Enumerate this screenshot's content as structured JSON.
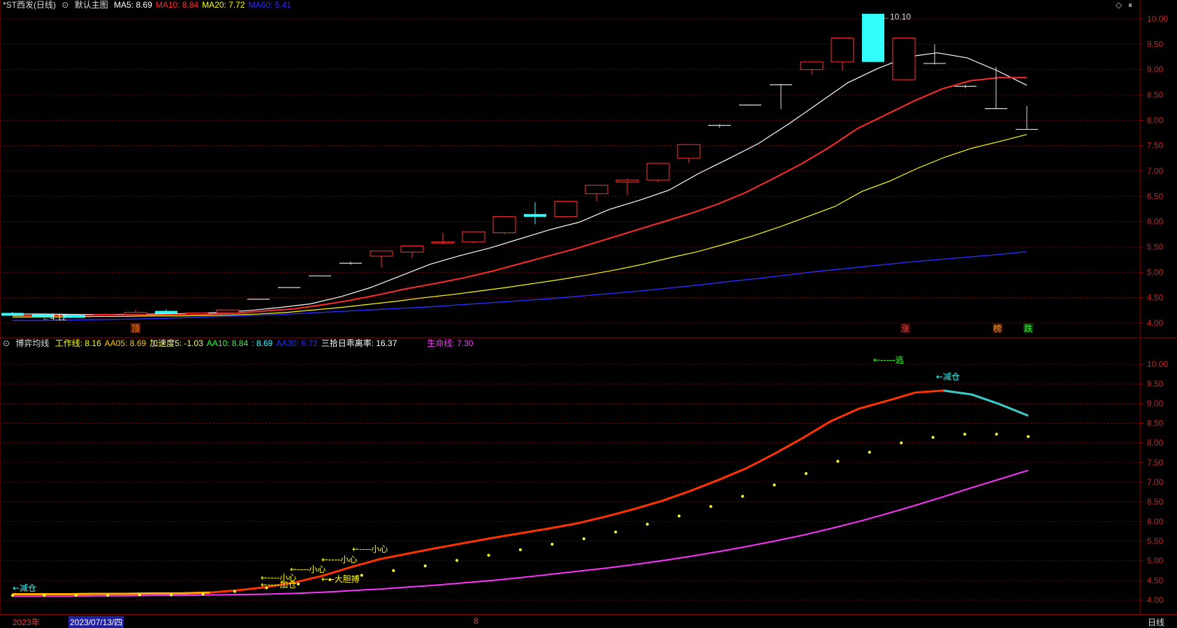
{
  "main_panel": {
    "title": "*ST西发(日线)",
    "template": "默认主图",
    "ma_labels": [
      {
        "text": "MA5: 8.69",
        "color": "#ffffff"
      },
      {
        "text": "MA10: 8.84",
        "color": "#ff2a2a"
      },
      {
        "text": "MA20: 7.72",
        "color": "#ffff00"
      },
      {
        "text": "MA60: 5.41",
        "color": "#2b2bff"
      }
    ],
    "high_label": "10.10",
    "low_label": "4.12",
    "y_ticks": [
      "10.00",
      "9.50",
      "9.00",
      "8.50",
      "8.00",
      "7.50",
      "7.00",
      "6.50",
      "6.00",
      "5.50",
      "5.00",
      "4.50",
      "4.00"
    ],
    "markers": [
      {
        "text": "顶",
        "color": "#ff8c00",
        "bg": "#5a1a00"
      },
      {
        "text": "涨",
        "color": "#ff4040",
        "bg": "#3a0000"
      },
      {
        "text": "榜",
        "color": "#ff9933",
        "bg": "#3a1a00"
      },
      {
        "text": "跌",
        "color": "#33ff33",
        "bg": "#003a00"
      }
    ],
    "icons": [
      {
        "name": "diamond-icon",
        "glyph": "◇"
      },
      {
        "name": "pause-icon",
        "glyph": "⏸"
      }
    ]
  },
  "sub_panel": {
    "indicator_name": "博弈均线",
    "labels": [
      {
        "text": "工作线: 8.16",
        "color": "#ffff00"
      },
      {
        "text": "AA05: 8.69",
        "color": "#ffcc00"
      },
      {
        "text": "加速度5: -1.03",
        "color": "#ffff66"
      },
      {
        "text": "AA10: 8.84",
        "color": "#33ff33"
      },
      {
        "text": ": 8.69",
        "color": "#33ffff"
      },
      {
        "text": "AA30: 6.72",
        "color": "#2b2bff"
      },
      {
        "text": "三拾日乖离率: 16.37",
        "color": "#ffffff"
      },
      {
        "text": "生命线: 7.30",
        "color": "#ff33ff"
      }
    ],
    "y_ticks": [
      "10.00",
      "9.50",
      "9.00",
      "8.50",
      "8.00",
      "7.50",
      "7.00",
      "6.50",
      "6.00",
      "5.50",
      "5.00",
      "4.50",
      "4.00"
    ],
    "annotations": [
      {
        "text": "←减仓",
        "color": "#33ffff"
      },
      {
        "text": "←----小心",
        "color": "#ffff00"
      },
      {
        "text": "←----加仓",
        "color": "#ffff00"
      },
      {
        "text": "←----小心",
        "color": "#ffff00"
      },
      {
        "text": "←----小心",
        "color": "#ffff00"
      },
      {
        "text": "←----小心",
        "color": "#ffff00"
      },
      {
        "text": "←--大胆搏",
        "color": "#ffff00"
      },
      {
        "text": "←-----逃",
        "color": "#33ff33"
      },
      {
        "text": "←减仓",
        "color": "#33ffff"
      }
    ]
  },
  "bottom_bar": {
    "year": "2023年",
    "date": "2023/07/13/四",
    "mid": "8",
    "period": "日线"
  },
  "chart_data": [
    {
      "type": "candlestick",
      "title": "*ST西发(日线)",
      "ylim": [
        3.85,
        10.15
      ],
      "candles": [
        {
          "o": 4.2,
          "h": 4.22,
          "l": 4.16,
          "c": 4.18,
          "color": "cyan"
        },
        {
          "o": 4.17,
          "h": 4.19,
          "l": 4.15,
          "c": 4.17,
          "color": "cyan"
        },
        {
          "o": 4.16,
          "h": 4.18,
          "l": 4.13,
          "c": 4.15,
          "color": "cyan"
        },
        {
          "o": 4.15,
          "h": 4.19,
          "l": 4.12,
          "c": 4.17,
          "color": "red"
        },
        {
          "o": 4.17,
          "h": 4.26,
          "l": 4.15,
          "c": 4.21,
          "color": "red"
        },
        {
          "o": 4.24,
          "h": 4.27,
          "l": 4.18,
          "c": 4.21,
          "color": "cyan"
        },
        {
          "o": 4.17,
          "h": 4.21,
          "l": 4.15,
          "c": 4.2,
          "color": "red"
        },
        {
          "o": 4.2,
          "h": 4.26,
          "l": 4.18,
          "c": 4.26,
          "color": "red"
        },
        {
          "o": 4.47,
          "h": 4.47,
          "l": 4.47,
          "c": 4.47,
          "color": "white"
        },
        {
          "o": 4.7,
          "h": 4.7,
          "l": 4.7,
          "c": 4.7,
          "color": "white"
        },
        {
          "o": 4.93,
          "h": 4.93,
          "l": 4.93,
          "c": 4.93,
          "color": "white"
        },
        {
          "o": 5.18,
          "h": 5.21,
          "l": 5.15,
          "c": 5.18,
          "color": "white"
        },
        {
          "o": 5.32,
          "h": 5.42,
          "l": 5.1,
          "c": 5.42,
          "color": "red"
        },
        {
          "o": 5.4,
          "h": 5.52,
          "l": 5.28,
          "c": 5.52,
          "color": "red"
        },
        {
          "o": 5.6,
          "h": 5.78,
          "l": 5.55,
          "c": 5.6,
          "color": "red"
        },
        {
          "o": 5.6,
          "h": 5.8,
          "l": 5.57,
          "c": 5.8,
          "color": "red"
        },
        {
          "o": 5.78,
          "h": 6.1,
          "l": 5.75,
          "c": 6.1,
          "color": "red"
        },
        {
          "o": 6.15,
          "h": 6.38,
          "l": 5.95,
          "c": 6.12,
          "color": "cyan"
        },
        {
          "o": 6.1,
          "h": 6.4,
          "l": 6.08,
          "c": 6.4,
          "color": "red"
        },
        {
          "o": 6.55,
          "h": 6.72,
          "l": 6.4,
          "c": 6.72,
          "color": "red"
        },
        {
          "o": 6.78,
          "h": 6.85,
          "l": 6.52,
          "c": 6.82,
          "color": "red"
        },
        {
          "o": 6.82,
          "h": 7.15,
          "l": 6.78,
          "c": 7.15,
          "color": "red"
        },
        {
          "o": 7.25,
          "h": 7.52,
          "l": 7.16,
          "c": 7.52,
          "color": "red"
        },
        {
          "o": 7.9,
          "h": 7.92,
          "l": 7.85,
          "c": 7.9,
          "color": "white"
        },
        {
          "o": 8.3,
          "h": 8.31,
          "l": 8.29,
          "c": 8.3,
          "color": "white"
        },
        {
          "o": 8.7,
          "h": 8.72,
          "l": 8.22,
          "c": 8.7,
          "color": "white"
        },
        {
          "o": 9.0,
          "h": 9.15,
          "l": 8.9,
          "c": 9.15,
          "color": "red"
        },
        {
          "o": 9.15,
          "h": 9.62,
          "l": 8.98,
          "c": 9.62,
          "color": "red"
        },
        {
          "o": 10.1,
          "h": 10.1,
          "l": 9.15,
          "c": 9.15,
          "color": "cyan"
        },
        {
          "o": 8.8,
          "h": 9.62,
          "l": 8.78,
          "c": 9.62,
          "color": "red"
        },
        {
          "o": 9.12,
          "h": 9.5,
          "l": 9.1,
          "c": 9.12,
          "color": "white"
        },
        {
          "o": 8.67,
          "h": 8.7,
          "l": 8.63,
          "c": 8.67,
          "color": "white"
        },
        {
          "o": 8.23,
          "h": 9.05,
          "l": 8.23,
          "c": 8.23,
          "color": "white"
        },
        {
          "o": 7.82,
          "h": 8.28,
          "l": 7.82,
          "c": 7.82,
          "color": "white"
        }
      ],
      "series": [
        {
          "name": "MA5",
          "color": "#ffffff",
          "values": [
            4.18,
            4.18,
            4.17,
            4.17,
            4.17,
            4.18,
            4.19,
            4.21,
            4.25,
            4.31,
            4.38,
            4.52,
            4.7,
            4.93,
            5.16,
            5.33,
            5.48,
            5.66,
            5.84,
            5.99,
            6.24,
            6.42,
            6.62,
            6.95,
            7.24,
            7.54,
            7.92,
            8.33,
            8.74,
            9.02,
            9.25,
            9.33,
            9.23,
            8.98,
            8.69
          ]
        },
        {
          "name": "MA10",
          "color": "#ff2a2a",
          "values": [
            4.15,
            4.15,
            4.15,
            4.16,
            4.16,
            4.16,
            4.17,
            4.18,
            4.2,
            4.24,
            4.28,
            4.36,
            4.45,
            4.56,
            4.68,
            4.78,
            4.89,
            5.02,
            5.17,
            5.32,
            5.47,
            5.64,
            5.81,
            5.98,
            6.15,
            6.34,
            6.57,
            6.85,
            7.14,
            7.47,
            7.84,
            8.11,
            8.38,
            8.62,
            8.78,
            8.84,
            8.84
          ]
        },
        {
          "name": "MA20",
          "color": "#ffff00",
          "values": [
            4.12,
            4.12,
            4.12,
            4.13,
            4.13,
            4.14,
            4.14,
            4.15,
            4.16,
            4.18,
            4.21,
            4.26,
            4.31,
            4.37,
            4.43,
            4.5,
            4.56,
            4.63,
            4.7,
            4.78,
            4.86,
            4.95,
            5.05,
            5.16,
            5.29,
            5.41,
            5.56,
            5.72,
            5.9,
            6.1,
            6.3,
            6.6,
            6.8,
            7.05,
            7.27,
            7.45,
            7.58,
            7.72
          ]
        },
        {
          "name": "MA60",
          "color": "#2b2bff",
          "values": [
            4.05,
            4.05,
            4.06,
            4.07,
            4.08,
            4.09,
            4.11,
            4.13,
            4.15,
            4.17,
            4.2,
            4.23,
            4.26,
            4.29,
            4.32,
            4.36,
            4.4,
            4.44,
            4.48,
            4.53,
            4.58,
            4.63,
            4.69,
            4.75,
            4.82,
            4.88,
            4.95,
            5.02,
            5.08,
            5.14,
            5.2,
            5.25,
            5.3,
            5.35,
            5.41
          ]
        }
      ]
    },
    {
      "type": "line",
      "title": "博弈均线",
      "ylim": [
        3.85,
        10.15
      ],
      "series": [
        {
          "name": "AA05",
          "color": "#ff3300",
          "values": [
            4.15,
            4.15,
            4.15,
            4.16,
            4.16,
            4.17,
            4.17,
            4.19,
            4.25,
            4.33,
            4.45,
            4.62,
            4.84,
            5.04,
            5.18,
            5.32,
            5.45,
            5.58,
            5.7,
            5.82,
            5.95,
            6.12,
            6.31,
            6.52,
            6.77,
            7.05,
            7.35,
            7.72,
            8.12,
            8.55,
            8.87,
            9.07,
            9.28,
            9.33,
            9.23,
            8.98,
            8.69
          ]
        },
        {
          "name": "生命线",
          "color": "#ff33ff",
          "values": [
            4.1,
            4.1,
            4.1,
            4.11,
            4.11,
            4.12,
            4.12,
            4.13,
            4.14,
            4.15,
            4.17,
            4.2,
            4.24,
            4.28,
            4.33,
            4.38,
            4.44,
            4.5,
            4.57,
            4.65,
            4.73,
            4.81,
            4.9,
            5.0,
            5.11,
            5.23,
            5.36,
            5.5,
            5.65,
            5.82,
            6.0,
            6.2,
            6.41,
            6.63,
            6.86,
            7.08,
            7.3
          ]
        },
        {
          "name": "工作线",
          "color": "#ffff00",
          "values": [
            4.12,
            4.12,
            4.12,
            4.12,
            4.13,
            4.13,
            4.15,
            4.22,
            4.31,
            4.41,
            4.52,
            4.63,
            4.75,
            4.87,
            5.01,
            5.14,
            5.28,
            5.42,
            5.56,
            5.73,
            5.93,
            6.14,
            6.38,
            6.64,
            6.93,
            7.22,
            7.53,
            7.76,
            8.0,
            8.14,
            8.22,
            8.22,
            8.16
          ]
        }
      ]
    }
  ]
}
